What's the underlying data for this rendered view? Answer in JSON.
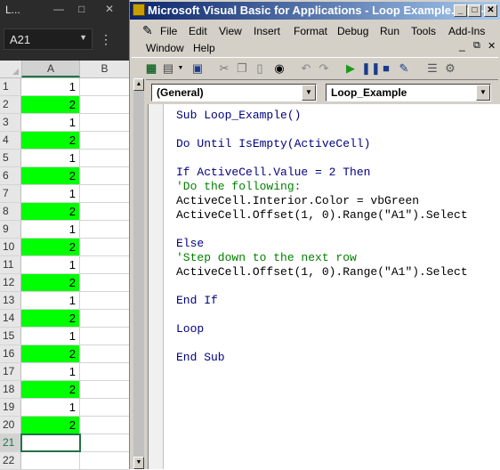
{
  "excel": {
    "title_fragment": "L...",
    "name_box": "A21",
    "column_headers": [
      "A",
      "B"
    ],
    "rows": [
      {
        "num": "1",
        "value": "1",
        "fill": "none"
      },
      {
        "num": "2",
        "value": "2",
        "fill": "green"
      },
      {
        "num": "3",
        "value": "1",
        "fill": "none"
      },
      {
        "num": "4",
        "value": "2",
        "fill": "green"
      },
      {
        "num": "5",
        "value": "1",
        "fill": "none"
      },
      {
        "num": "6",
        "value": "2",
        "fill": "green"
      },
      {
        "num": "7",
        "value": "1",
        "fill": "none"
      },
      {
        "num": "8",
        "value": "2",
        "fill": "green"
      },
      {
        "num": "9",
        "value": "1",
        "fill": "none"
      },
      {
        "num": "10",
        "value": "2",
        "fill": "green"
      },
      {
        "num": "11",
        "value": "1",
        "fill": "none"
      },
      {
        "num": "12",
        "value": "2",
        "fill": "green"
      },
      {
        "num": "13",
        "value": "1",
        "fill": "none"
      },
      {
        "num": "14",
        "value": "2",
        "fill": "green"
      },
      {
        "num": "15",
        "value": "1",
        "fill": "none"
      },
      {
        "num": "16",
        "value": "2",
        "fill": "green"
      },
      {
        "num": "17",
        "value": "1",
        "fill": "none"
      },
      {
        "num": "18",
        "value": "2",
        "fill": "green"
      },
      {
        "num": "19",
        "value": "1",
        "fill": "none"
      },
      {
        "num": "20",
        "value": "2",
        "fill": "green"
      },
      {
        "num": "21",
        "value": "",
        "fill": "none",
        "selected": true
      },
      {
        "num": "22",
        "value": "",
        "fill": "none"
      }
    ],
    "green_color": "#00ff00",
    "accent_color": "#217346"
  },
  "vba": {
    "title": "Microsoft Visual Basic for Applications - Loop Example.xlsx -...",
    "menu": {
      "file": "File",
      "edit": "Edit",
      "view": "View",
      "insert": "Insert",
      "format": "Format",
      "debug": "Debug",
      "run": "Run",
      "tools": "Tools",
      "addins": "Add-Ins",
      "window": "Window",
      "help": "Help"
    },
    "object_combo": "(General)",
    "procedure_combo": "Loop_Example",
    "code_lines": [
      {
        "text": "Sub Loop_Example()",
        "style": "kw"
      },
      {
        "text": "",
        "style": ""
      },
      {
        "text": "Do Until IsEmpty(ActiveCell)",
        "style": "kw"
      },
      {
        "text": "",
        "style": ""
      },
      {
        "text": "If ActiveCell.Value = 2 Then",
        "style": "kw"
      },
      {
        "text": "'Do the following:",
        "style": "cm"
      },
      {
        "text": "ActiveCell.Interior.Color = vbGreen",
        "style": ""
      },
      {
        "text": "ActiveCell.Offset(1, 0).Range(\"A1\").Select",
        "style": ""
      },
      {
        "text": "",
        "style": ""
      },
      {
        "text": "Else",
        "style": "kw"
      },
      {
        "text": "'Step down to the next row",
        "style": "cm"
      },
      {
        "text": "ActiveCell.Offset(1, 0).Range(\"A1\").Select",
        "style": ""
      },
      {
        "text": "",
        "style": ""
      },
      {
        "text": "End If",
        "style": "kw"
      },
      {
        "text": "",
        "style": ""
      },
      {
        "text": "Loop",
        "style": "kw"
      },
      {
        "text": "",
        "style": ""
      },
      {
        "text": "End Sub",
        "style": "kw"
      }
    ],
    "keyword_color": "#00007f",
    "comment_color": "#008000"
  }
}
